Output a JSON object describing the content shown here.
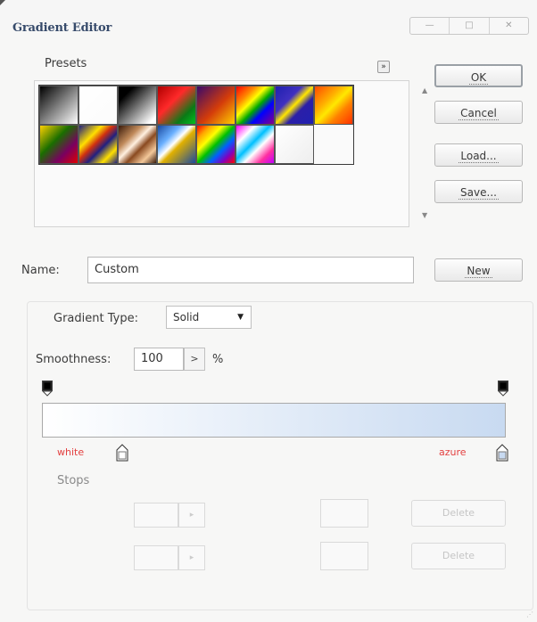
{
  "window": {
    "title": "Gradient Editor",
    "controls": [
      "—",
      "□",
      "✕"
    ]
  },
  "presets": {
    "label": "Presets",
    "menu_glyph": "»",
    "swatches": [
      "linear-gradient(135deg,#000 0%,#fff 100%)",
      "linear-gradient(135deg,#ffffff 0%,rgba(255,255,255,0.2) 100%)",
      "linear-gradient(135deg,#000 20%,#ffffff 90%)",
      "linear-gradient(135deg,#b00000 0%,#ff2a2a 40%,#0a7a16 75%,#00c020 100%)",
      "linear-gradient(135deg,#3a0a6a 0%,#d43c0a 55%,#ffd000 100%)",
      "linear-gradient(135deg,#f00 0%,#f80 25%,#ff0 40%,#0a0 55%,#00f 70%,#808 100%)",
      "linear-gradient(135deg,#2020b0 0%,#4030c0 35%,#ffe600 50%,#2b1fa8 65%,#2020b0 100%)",
      "linear-gradient(135deg,#ff4800 0%,#ffb000 35%,#ffe800 50%,#ff8000 70%,#ff3000 100%)",
      "linear-gradient(135deg,#ffd000 0%,#1a6e00 40%,#7a0060 70%,#e00000 100%)",
      "linear-gradient(135deg,#202080 0%,#ffe000 30%,#d03010 45%,#202080 60%,#ffe000 80%,#202080 100%)",
      "linear-gradient(135deg,#3a1a0a 0%,#c08a5a 30%,#fff0e0 45%,#8a4a20 60%,#f3c89a 80%,#3a1a0a 100%)",
      "linear-gradient(135deg,#1a4aa0 0%,#6ab0ff 30%,#ffffff 45%,#e0b000 55%,#1a4aa0 100%)",
      "linear-gradient(135deg,#ff0000 0%,#ffa500 18%,#ffff00 34%,#00c000 50%,#0060ff 66%,#8000c0 82%,#ff0000 100%)",
      "linear-gradient(135deg,#ff00ff 0%,#ffffff 25%,#00c0ff 45%,#ffffff 60%,#ff30a0 80%,#c000ff 100%)",
      "linear-gradient(135deg,#ffffff 0%,#eeeeee 100%)"
    ]
  },
  "buttons": {
    "ok": "OK",
    "cancel": "Cancel",
    "load": "Load...",
    "save": "Save...",
    "new": "New"
  },
  "name_field": {
    "label": "Name:",
    "value": "Custom"
  },
  "gradient": {
    "type_label": "Gradient Type:",
    "type_value": "Solid",
    "smoothness_label": "Smoothness:",
    "smoothness_value": "100",
    "smoothness_unit": "%",
    "stepper_glyph": ">",
    "start_color": "#ffffff",
    "end_color": "#c8daf1",
    "left_color_name": "white",
    "right_color_name": "azure"
  },
  "stops": {
    "label": "Stops",
    "row1_button": "Delete",
    "row2_button": "Delete",
    "row1_stepper": "▸",
    "row2_stepper": "▸"
  },
  "colors": {
    "title": "#364a6a",
    "label_red": "#e34040"
  }
}
